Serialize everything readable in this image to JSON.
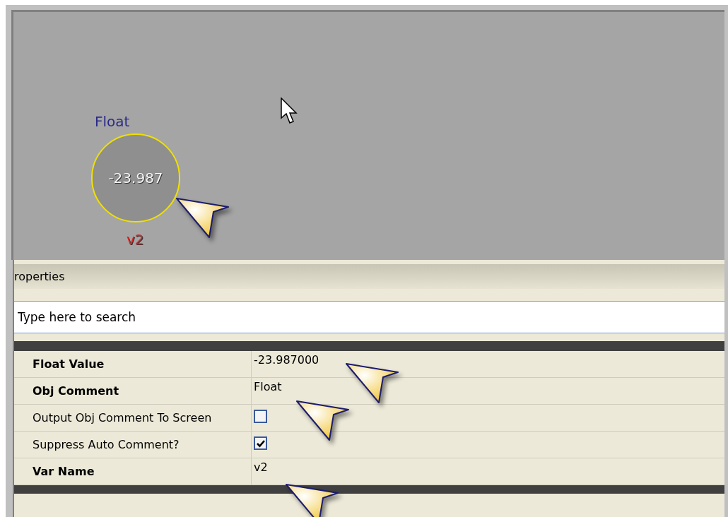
{
  "canvas": {
    "node": {
      "type_label": "Float",
      "value": "-23.987",
      "var_name": "v2"
    }
  },
  "properties": {
    "title": "roperties",
    "search": {
      "placeholder": "Type here to search"
    },
    "rows": [
      {
        "kind": "text",
        "label": "Float Value",
        "bold": true,
        "value": "-23.987000"
      },
      {
        "kind": "text",
        "label": "Obj Comment",
        "bold": true,
        "value": "Float"
      },
      {
        "kind": "checkbox",
        "label": "Output Obj Comment To Screen",
        "bold": false,
        "checked": false
      },
      {
        "kind": "checkbox",
        "label": "Suppress Auto Comment?",
        "bold": false,
        "checked": true
      },
      {
        "kind": "text",
        "label": "Var Name",
        "bold": true,
        "value": "v2"
      }
    ]
  }
}
